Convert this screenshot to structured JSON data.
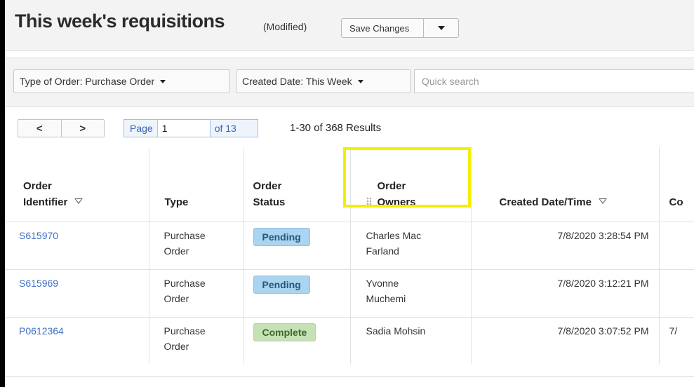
{
  "header": {
    "title": "This week's requisitions",
    "modified": "(Modified)",
    "save_label": "Save Changes",
    "save_menu_icon": "caret-down-icon"
  },
  "filters": {
    "type_of_order": "Type of Order: Purchase Order",
    "created_date": "Created Date: This Week",
    "search_placeholder": "Quick search",
    "search_value": ""
  },
  "pager": {
    "prev_icon": "chevron-left-icon",
    "next_icon": "chevron-right-icon",
    "prev": "<",
    "next": ">",
    "page_label": "Page",
    "page_value": "1",
    "of_label": "of 13",
    "results": "1-30 of 368 Results"
  },
  "table": {
    "columns": [
      {
        "line1": "Order",
        "line2": "Identifier",
        "sortable": true
      },
      {
        "line1": "",
        "line2": "Type",
        "sortable": false
      },
      {
        "line1": "Order",
        "line2": "Status",
        "sortable": false
      },
      {
        "line1": "Order",
        "line2": "Owners",
        "sortable": false,
        "highlighted": true,
        "drag_icon": "drag-handle-icon"
      },
      {
        "line1": "",
        "line2": "Created Date/Time",
        "sortable": true
      },
      {
        "line1": "",
        "line2": "Co",
        "sortable": false
      }
    ],
    "rows": [
      {
        "id": "S615970",
        "type_l1": "Purchase",
        "type_l2": "Order",
        "status": "Pending",
        "owner_l1": "Charles Mac",
        "owner_l2": "Farland",
        "created": "7/8/2020 3:28:54 PM",
        "extra": ""
      },
      {
        "id": "S615969",
        "type_l1": "Purchase",
        "type_l2": "Order",
        "status": "Pending",
        "owner_l1": "Yvonne",
        "owner_l2": "Muchemi",
        "created": "7/8/2020 3:12:21 PM",
        "extra": ""
      },
      {
        "id": "P0612364",
        "type_l1": "Purchase",
        "type_l2": "Order",
        "status": "Complete",
        "owner_l1": "Sadia Mohsin",
        "owner_l2": "",
        "created": "7/8/2020 3:07:52 PM",
        "extra": "7/"
      }
    ]
  },
  "colors": {
    "highlight": "#f4ef00",
    "link": "#3f6fc6",
    "pending": "#aad4ef",
    "complete": "#c6e1b5"
  }
}
